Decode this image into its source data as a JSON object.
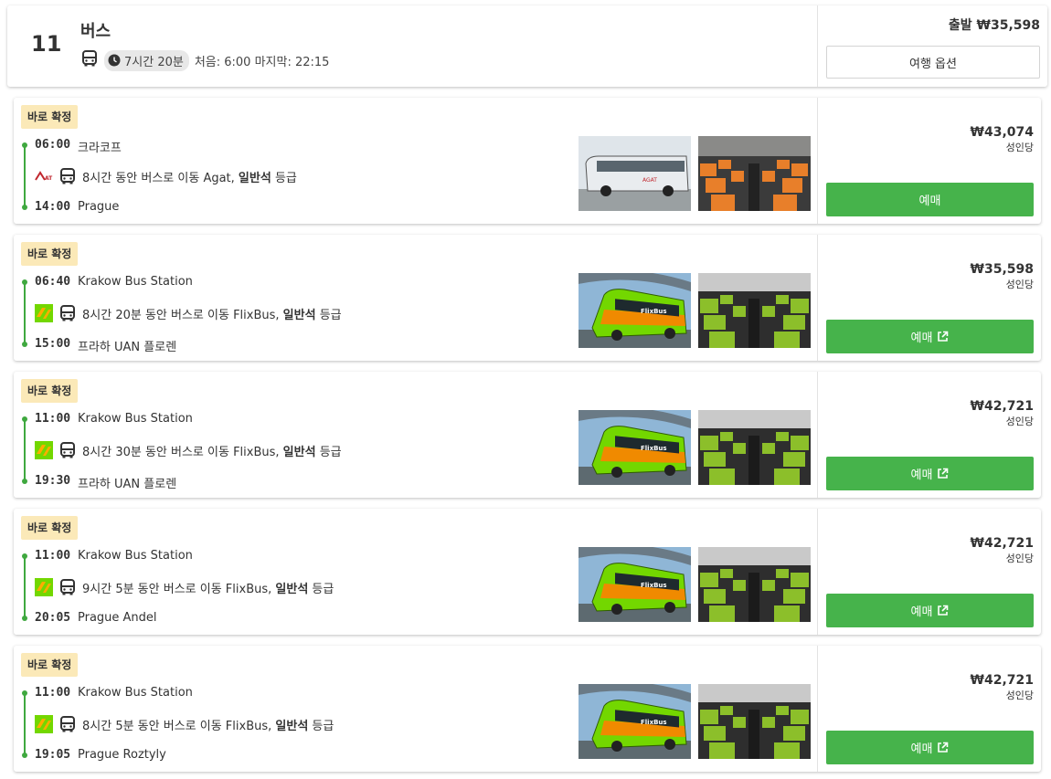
{
  "header": {
    "count": "11",
    "title": "버스",
    "duration": "7시간 20분",
    "first_last": "처음: 6:00 마지막: 22:15",
    "price": "출발 ₩35,598",
    "options_label": "여행 옵션"
  },
  "trips": [
    {
      "badge": "바로 확정",
      "dep_time": "06:00",
      "dep_station": "크라코프",
      "seg_prefix": "8시간 동안 버스로 이동 Agat, ",
      "seg_class": "일반석",
      "seg_suffix": " 등급",
      "arr_time": "14:00",
      "arr_station": "Prague",
      "operator_logo": "agat-logo",
      "price": "₩43,074",
      "per_adult": "성인당",
      "book_label": "예매",
      "external": false
    },
    {
      "badge": "바로 확정",
      "dep_time": "06:40",
      "dep_station": "Krakow Bus Station",
      "seg_prefix": "8시간 20분 동안 버스로 이동 FlixBus, ",
      "seg_class": "일반석",
      "seg_suffix": " 등급",
      "arr_time": "15:00",
      "arr_station": "프라하 UAN 플로렌",
      "operator_logo": "flixbus-logo",
      "price": "₩35,598",
      "per_adult": "성인당",
      "book_label": "예매",
      "external": true
    },
    {
      "badge": "바로 확정",
      "dep_time": "11:00",
      "dep_station": "Krakow Bus Station",
      "seg_prefix": "8시간 30분 동안 버스로 이동 FlixBus, ",
      "seg_class": "일반석",
      "seg_suffix": " 등급",
      "arr_time": "19:30",
      "arr_station": "프라하 UAN 플로렌",
      "operator_logo": "flixbus-logo",
      "price": "₩42,721",
      "per_adult": "성인당",
      "book_label": "예매",
      "external": true
    },
    {
      "badge": "바로 확정",
      "dep_time": "11:00",
      "dep_station": "Krakow Bus Station",
      "seg_prefix": "9시간 5분 동안 버스로 이동 FlixBus, ",
      "seg_class": "일반석",
      "seg_suffix": " 등급",
      "arr_time": "20:05",
      "arr_station": "Prague Andel",
      "operator_logo": "flixbus-logo",
      "price": "₩42,721",
      "per_adult": "성인당",
      "book_label": "예매",
      "external": true
    },
    {
      "badge": "바로 확정",
      "dep_time": "11:00",
      "dep_station": "Krakow Bus Station",
      "seg_prefix": "8시간 5분 동안 버스로 이동 FlixBus, ",
      "seg_class": "일반석",
      "seg_suffix": " 등급",
      "arr_time": "19:05",
      "arr_station": "Prague Roztyly",
      "operator_logo": "flixbus-logo",
      "price": "₩42,721",
      "per_adult": "성인당",
      "book_label": "예매",
      "external": true
    }
  ],
  "colors": {
    "accent_green": "#46b34b",
    "timeline_green": "#3fa83f",
    "badge_bg": "#fbe9b8"
  }
}
